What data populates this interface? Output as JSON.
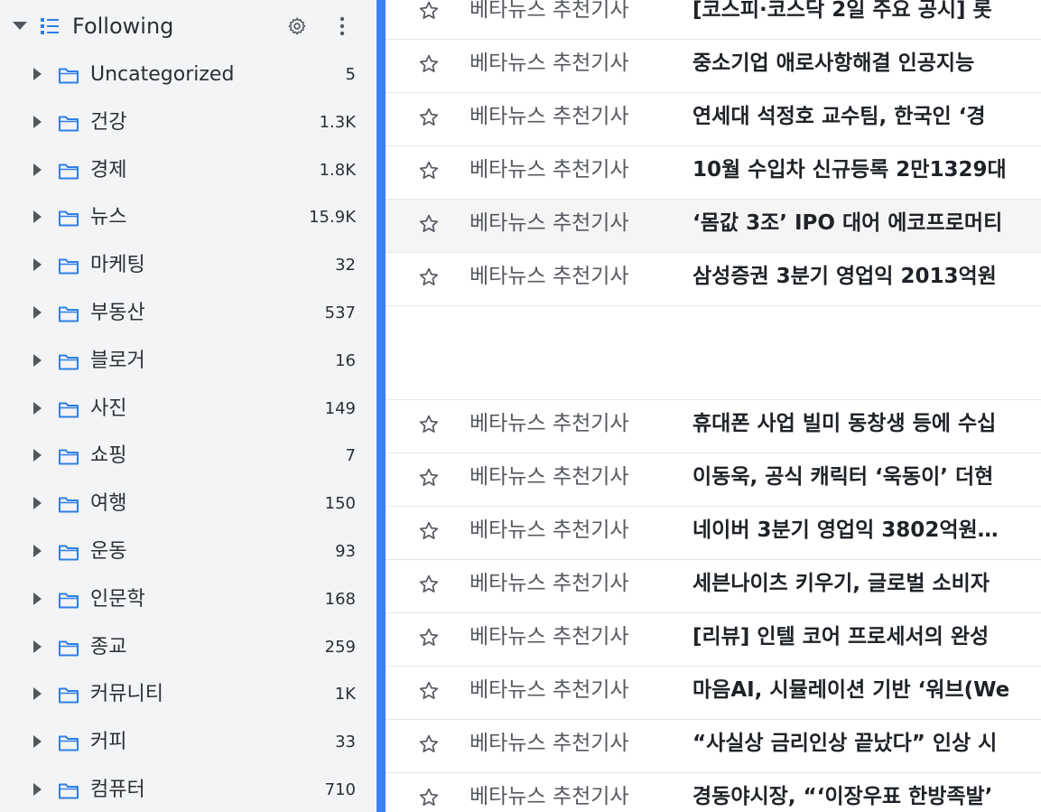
{
  "sidebar": {
    "header": {
      "title": "Following",
      "icons": [
        "caret-down-icon",
        "list-icon",
        "gear-icon",
        "more-vertical-icon"
      ]
    },
    "folders": [
      {
        "label": "Uncategorized",
        "count": "5"
      },
      {
        "label": "건강",
        "count": "1.3K"
      },
      {
        "label": "경제",
        "count": "1.8K"
      },
      {
        "label": "뉴스",
        "count": "15.9K"
      },
      {
        "label": "마케팅",
        "count": "32"
      },
      {
        "label": "부동산",
        "count": "537"
      },
      {
        "label": "블로거",
        "count": "16"
      },
      {
        "label": "사진",
        "count": "149"
      },
      {
        "label": "쇼핑",
        "count": "7"
      },
      {
        "label": "여행",
        "count": "150"
      },
      {
        "label": "운동",
        "count": "93"
      },
      {
        "label": "인문학",
        "count": "168"
      },
      {
        "label": "종교",
        "count": "259"
      },
      {
        "label": "커뮤니티",
        "count": "1K"
      },
      {
        "label": "커피",
        "count": "33"
      },
      {
        "label": "컴퓨터",
        "count": "710"
      }
    ]
  },
  "articles_top": [
    {
      "source": "베타뉴스 추천기사",
      "title": "[코스피·코스닥 2일 주요 공시] 롯"
    },
    {
      "source": "베타뉴스 추천기사",
      "title": "중소기업 애로사항해결 인공지능"
    },
    {
      "source": "베타뉴스 추천기사",
      "title": "연세대 석정호 교수팀, 한국인 ‘경"
    },
    {
      "source": "베타뉴스 추천기사",
      "title": "10월 수입차 신규등록 2만1329대"
    },
    {
      "source": "베타뉴스 추천기사",
      "title": "‘몸값 3조’ IPO 대어 에코프로머티"
    },
    {
      "source": "베타뉴스 추천기사",
      "title": "삼성증권 3분기 영업익 2013억원"
    }
  ],
  "articles_bottom": [
    {
      "source": "베타뉴스 추천기사",
      "title": "휴대폰 사업 빌미 동창생 등에 수십"
    },
    {
      "source": "베타뉴스 추천기사",
      "title": "이동욱, 공식 캐릭터 ‘욱동이’ 더현"
    },
    {
      "source": "베타뉴스 추천기사",
      "title": "네이버 3분기 영업익 3802억원…"
    },
    {
      "source": "베타뉴스 추천기사",
      "title": "세븐나이츠 키우기, 글로벌 소비자"
    },
    {
      "source": "베타뉴스 추천기사",
      "title": "[리뷰] 인텔 코어 프로세서의 완성"
    },
    {
      "source": "베타뉴스 추천기사",
      "title": "마음AI, 시뮬레이션 기반 ‘워브(We"
    },
    {
      "source": "베타뉴스 추천기사",
      "title": "“사실상 금리인상 끝났다” 인상 시"
    },
    {
      "source": "베타뉴스 추천기사",
      "title": "경동야시장, “‘이장우표 한방족발’"
    }
  ],
  "colors": {
    "sidebar_bg": "#f3f4f6",
    "accent": "#3b82f6",
    "icon_blue": "#2f7fe6",
    "hover_row": "#f5f5f6"
  }
}
